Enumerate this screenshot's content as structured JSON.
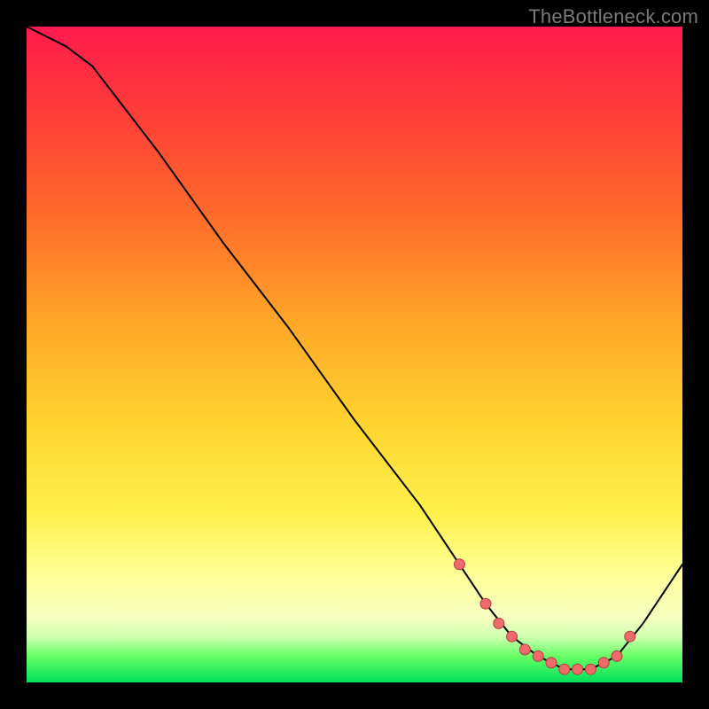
{
  "watermark": "TheBottleneck.com",
  "colors": {
    "curve": "#000000",
    "outline": "#000000",
    "marker_fill": "#ef6b6b",
    "marker_stroke": "#b43c3c"
  },
  "chart_data": {
    "type": "line",
    "title": "",
    "xlabel": "",
    "ylabel": "",
    "xlim": [
      0,
      100
    ],
    "ylim": [
      0,
      100
    ],
    "series": [
      {
        "name": "bottleneck-curve",
        "x": [
          0,
          6,
          10,
          20,
          30,
          40,
          50,
          60,
          66,
          70,
          74,
          78,
          82,
          86,
          90,
          94,
          100
        ],
        "y": [
          100,
          97,
          94,
          81,
          67,
          54,
          40,
          27,
          18,
          12,
          7,
          4,
          2,
          2,
          4,
          9,
          18
        ]
      }
    ],
    "markers": {
      "name": "highlight-points",
      "x": [
        66,
        70,
        72,
        74,
        76,
        78,
        80,
        82,
        84,
        86,
        88,
        90,
        92
      ],
      "y": [
        18,
        12,
        9,
        7,
        5,
        4,
        3,
        2,
        2,
        2,
        3,
        4,
        7
      ]
    }
  }
}
